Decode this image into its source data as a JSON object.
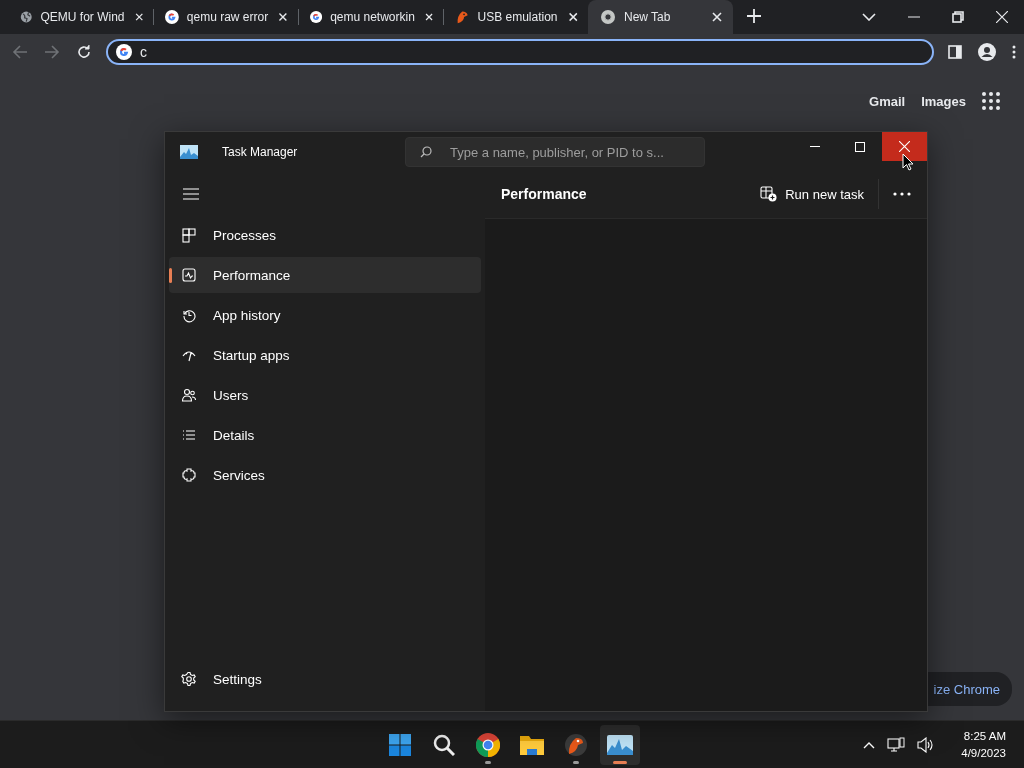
{
  "browser": {
    "tabs": [
      {
        "title": "QEMU for Wind",
        "selected": false
      },
      {
        "title": "qemu raw error",
        "selected": false
      },
      {
        "title": "qemu networkin",
        "selected": false
      },
      {
        "title": "USB emulation",
        "selected": false
      },
      {
        "title": "New Tab",
        "selected": true
      }
    ],
    "address_bar": {
      "value": "c"
    },
    "links": [
      "Gmail",
      "Images"
    ],
    "customize_button": "ize Chrome"
  },
  "task_manager": {
    "title": "Task Manager",
    "search": {
      "placeholder": "Type a name, publisher, or PID to s..."
    },
    "nav_items": [
      {
        "label": "Processes",
        "selected": false
      },
      {
        "label": "Performance",
        "selected": true
      },
      {
        "label": "App history",
        "selected": false
      },
      {
        "label": "Startup apps",
        "selected": false
      },
      {
        "label": "Users",
        "selected": false
      },
      {
        "label": "Details",
        "selected": false
      },
      {
        "label": "Services",
        "selected": false
      }
    ],
    "settings": "Settings",
    "page_title": "Performance",
    "run_new_task": "Run new task"
  },
  "taskbar": {
    "apps": [
      {
        "running": false,
        "active": false
      },
      {
        "running": false,
        "active": false
      },
      {
        "running": true,
        "active": false
      },
      {
        "running": false,
        "active": false
      },
      {
        "running": true,
        "active": false
      },
      {
        "running": true,
        "active": true
      }
    ],
    "time": "8:25 AM",
    "date": "4/9/2023"
  }
}
